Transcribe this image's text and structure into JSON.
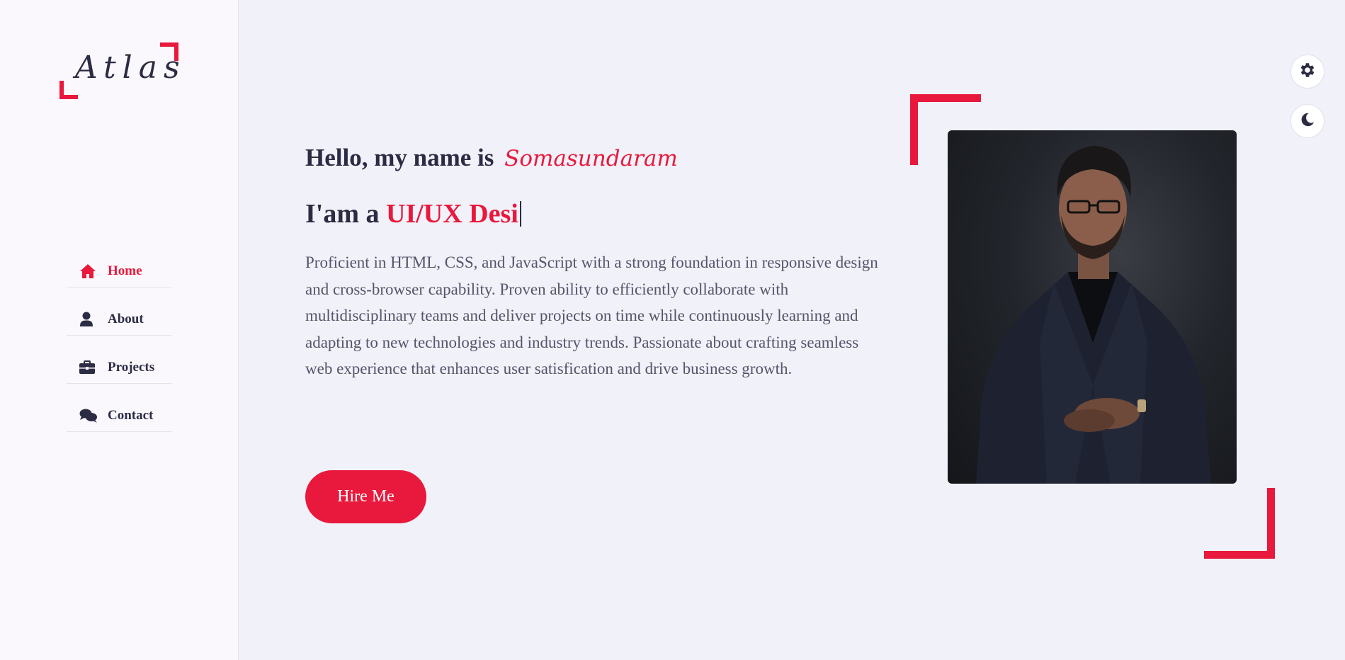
{
  "logo": {
    "text": "Atlas"
  },
  "nav": {
    "items": [
      {
        "label": "Home",
        "icon": "home-icon",
        "active": true
      },
      {
        "label": "About",
        "icon": "user-icon",
        "active": false
      },
      {
        "label": "Projects",
        "icon": "briefcase-icon",
        "active": false
      },
      {
        "label": "Contact",
        "icon": "comments-icon",
        "active": false
      }
    ]
  },
  "hero": {
    "greeting_prefix": "Hello, my name is",
    "name": "Somasundaram",
    "role_prefix": "I'am a",
    "role_typed": "UI/UX Desi",
    "bio": "Proficient in HTML, CSS, and JavaScript with a strong foundation in responsive design and cross-browser capability. Proven ability to efficiently collaborate with multidisciplinary teams and deliver projects on time while continuously learning and adapting to new technologies and industry trends. Passionate about crafting seamless web experience that enhances user satisfication and drive business growth.",
    "cta_label": "Hire Me"
  },
  "controls": {
    "settings_icon": "gear-icon",
    "theme_icon": "moon-icon"
  },
  "colors": {
    "accent": "#e8193c",
    "text": "#2b2b44",
    "background": "#f1f1fa",
    "sidebar": "#fbf8fd"
  }
}
